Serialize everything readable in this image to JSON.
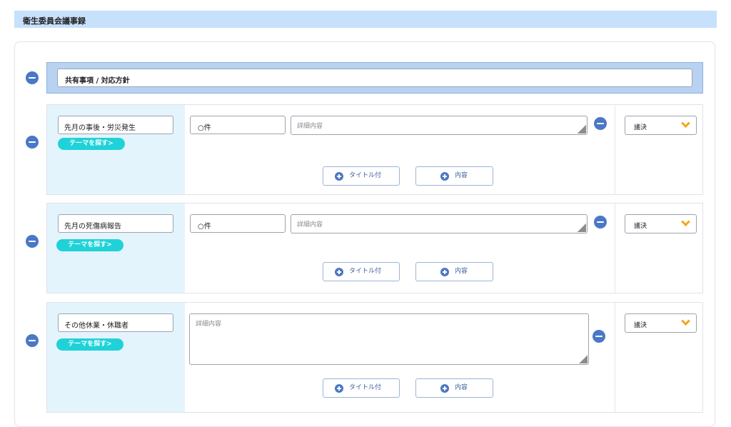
{
  "header": {
    "title": "衛生委員会議事録"
  },
  "shared": {
    "value": "共有事項 / 対応方針"
  },
  "rows": [
    {
      "theme": "先月の事後・労災発生",
      "theme_button": "テーマを探す>",
      "count": "○件",
      "detail_placeholder": "詳細内容",
      "vote": "議決",
      "add_title": "タイトル付",
      "add_content": "内容"
    },
    {
      "theme": "先月の死傷病報告",
      "theme_button": "テーマを探す>",
      "count": "○件",
      "detail_placeholder": "詳細内容",
      "vote": "議決",
      "add_title": "タイトル付",
      "add_content": "内容"
    },
    {
      "theme": "その他休業・休職者",
      "theme_button": "テーマを探す>",
      "detail_placeholder": "詳細内容",
      "vote": "議決",
      "add_title": "タイトル付",
      "add_content": "内容"
    }
  ],
  "colors": {
    "header_bg": "#c7e0fb",
    "accent_blue": "#4a78c6",
    "theme_button": "#1fd2d8",
    "chevron": "#f5a51e"
  }
}
